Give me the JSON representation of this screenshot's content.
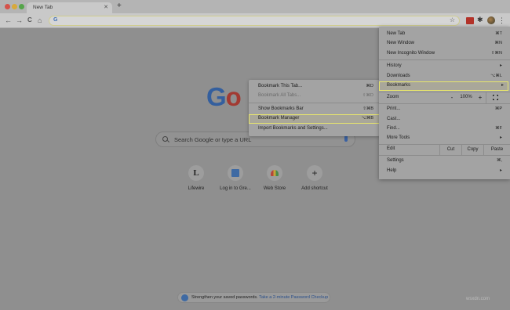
{
  "window": {
    "tab_title": "New Tab",
    "tab_close": "✕",
    "new_tab_glyph": "+"
  },
  "toolbar": {
    "back_glyph": "←",
    "forward_glyph": "→",
    "reload_glyph": "C",
    "home_glyph": "⌂",
    "omnibox_value": "",
    "site_icon": "G",
    "bookmark_star": "☆",
    "menu_glyph": "⋮"
  },
  "page": {
    "logo": {
      "g": "G",
      "o": "o"
    },
    "search_placeholder": "Search Google or type a URL",
    "shortcuts": [
      {
        "label": "Lifewire",
        "glyph": "L"
      },
      {
        "label": "Log in to Gre...",
        "glyph": ""
      },
      {
        "label": "Web Store",
        "glyph": ""
      },
      {
        "label": "Add shortcut",
        "glyph": "+"
      }
    ],
    "notice": {
      "text": "Strengthen your saved passwords.",
      "link": "Take a 2-minute Password Checkup"
    }
  },
  "bookmarks_submenu": {
    "items": [
      {
        "label": "Bookmark This Tab...",
        "shortcut": "⌘D"
      },
      {
        "label": "Bookmark All Tabs...",
        "shortcut": "⇧⌘D"
      },
      {
        "label": "Show Bookmarks Bar",
        "shortcut": "⇧⌘B"
      },
      {
        "label": "Bookmark Manager",
        "shortcut": "⌥⌘B"
      },
      {
        "label": "Import Bookmarks and Settings...",
        "shortcut": ""
      }
    ]
  },
  "chrome_menu": {
    "new_tab": {
      "label": "New Tab",
      "shortcut": "⌘T"
    },
    "new_window": {
      "label": "New Window",
      "shortcut": "⌘N"
    },
    "new_incognito": {
      "label": "New Incognito Window",
      "shortcut": "⇧⌘N"
    },
    "history": {
      "label": "History",
      "arrow": "▸"
    },
    "downloads": {
      "label": "Downloads",
      "shortcut": "⌥⌘L"
    },
    "bookmarks": {
      "label": "Bookmarks",
      "arrow": "▸"
    },
    "zoom": {
      "label": "Zoom",
      "minus": "-",
      "value": "100%",
      "plus": "+"
    },
    "print": {
      "label": "Print...",
      "shortcut": "⌘P"
    },
    "cast": {
      "label": "Cast..."
    },
    "find": {
      "label": "Find...",
      "shortcut": "⌘F"
    },
    "more_tools": {
      "label": "More Tools",
      "arrow": "▸"
    },
    "edit": {
      "label": "Edit",
      "cut": "Cut",
      "copy": "Copy",
      "paste": "Paste"
    },
    "settings": {
      "label": "Settings",
      "shortcut": "⌘,"
    },
    "help": {
      "label": "Help",
      "arrow": "▸"
    }
  },
  "watermark": "wsxdn.com"
}
